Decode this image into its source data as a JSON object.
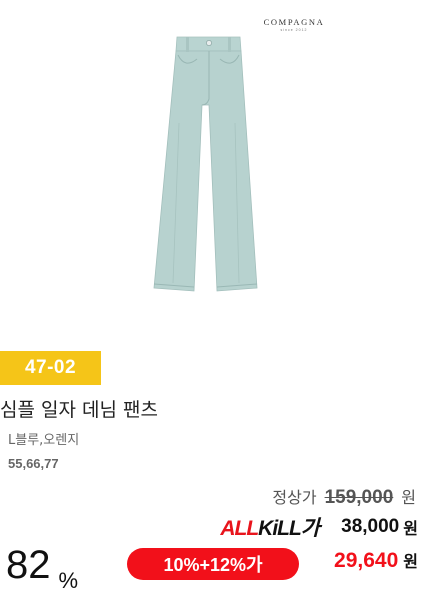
{
  "brand": {
    "name": "COMPAGNA",
    "sub": "since 2012"
  },
  "product": {
    "image_icon": "denim-pants-image",
    "code": "47-02",
    "title": "심플 일자 데님 팬츠",
    "colors": "L블루,오렌지",
    "sizes": "55,66,77"
  },
  "pricing": {
    "original_label": "정상가",
    "original_price": "159,000",
    "currency": "원",
    "allkill_logo_red": "ALL",
    "allkill_logo_black": "KiLL가",
    "allkill_price": "38,000",
    "discount_percent": "82",
    "percent_symbol": "%",
    "coupon_label": "10%+12%가",
    "final_price": "29,640"
  },
  "colors": {
    "badge_yellow": "#f5c518",
    "accent_red": "#f2101a",
    "pants_blue": "#b7d2cf"
  }
}
